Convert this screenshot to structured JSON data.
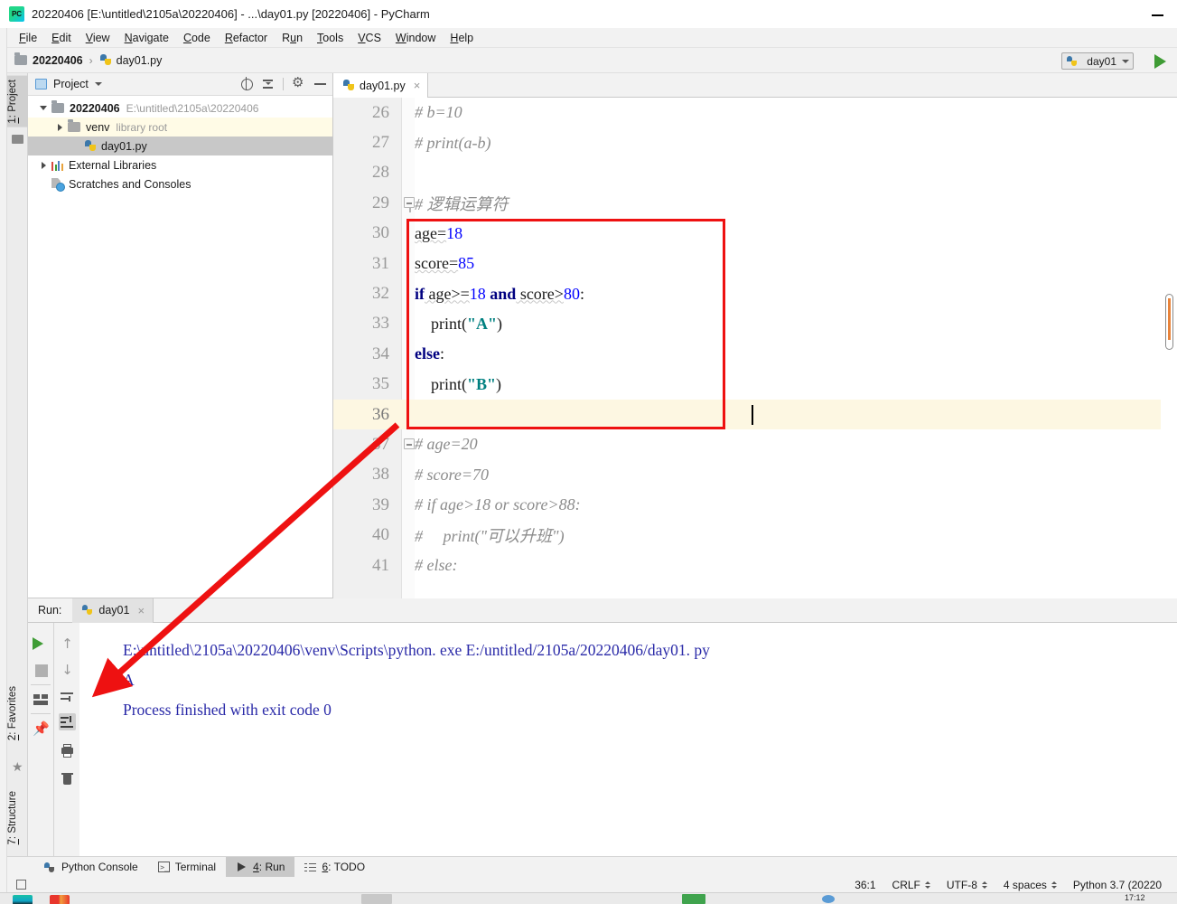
{
  "window": {
    "title": "20220406 [E:\\untitled\\2105a\\20220406] - ...\\day01.py [20220406] - PyCharm",
    "logo": "pycharm-logo",
    "minimize": "minimize-icon"
  },
  "menubar": {
    "items": [
      {
        "mnemonic": "F",
        "rest": "ile"
      },
      {
        "mnemonic": "E",
        "rest": "dit"
      },
      {
        "mnemonic": "V",
        "rest": "iew"
      },
      {
        "mnemonic": "N",
        "rest": "avigate"
      },
      {
        "mnemonic": "C",
        "rest": "ode"
      },
      {
        "mnemonic": "R",
        "rest": "efactor"
      },
      {
        "mnemonic": "R",
        "rest": "un",
        "pre": "R",
        "post": "un"
      },
      {
        "mnemonic": "T",
        "rest": "ools"
      },
      {
        "mnemonic": "V",
        "rest": "CS"
      },
      {
        "mnemonic": "W",
        "rest": "indow"
      },
      {
        "mnemonic": "H",
        "rest": "elp"
      }
    ],
    "labels": [
      "File",
      "Edit",
      "View",
      "Navigate",
      "Code",
      "Refactor",
      "Run",
      "Tools",
      "VCS",
      "Window",
      "Help"
    ]
  },
  "navbar": {
    "breadcrumb": [
      {
        "label": "20220406",
        "icon": "folder-icon",
        "bold": true
      },
      {
        "label": "day01.py",
        "icon": "python-file-icon",
        "bold": false
      }
    ],
    "separator": "›",
    "run_config": {
      "label": "day01",
      "icon": "python-config-icon"
    },
    "run_button": "run-icon"
  },
  "left_toolstrip": {
    "top_tab": {
      "mnemonic": "1",
      "label": ": Project"
    },
    "top_tab_full": "1: Project",
    "bottom_tabs": [
      {
        "mnemonic": "2",
        "label": ": Favorites",
        "full": "2: Favorites"
      },
      {
        "mnemonic": "7",
        "label": ": Structure",
        "full": "7: Structure"
      }
    ]
  },
  "project_panel": {
    "header": {
      "title": "Project",
      "icons": [
        "locate-target-icon",
        "collapse-all-icon",
        "gear-icon",
        "hide-icon"
      ]
    },
    "tree": [
      {
        "label": "20220406",
        "path": "E:\\untitled\\2105a\\20220406",
        "icon": "folder-icon",
        "expanded": true,
        "depth": 0,
        "bold": true
      },
      {
        "label": "venv",
        "sub": "library root",
        "icon": "folder-venv-icon",
        "expanded": false,
        "depth": 1,
        "highlight": "yellow"
      },
      {
        "label": "day01.py",
        "icon": "python-file-icon",
        "depth": 2,
        "highlight": "gray"
      },
      {
        "label": "External Libraries",
        "icon": "libraries-icon",
        "expanded": false,
        "depth": 0
      },
      {
        "label": "Scratches and Consoles",
        "icon": "scratches-icon",
        "depth": 0
      }
    ]
  },
  "editor": {
    "tab": {
      "label": "day01.py",
      "icon": "python-file-icon",
      "close": "×"
    },
    "caret_position": "36:1",
    "scrollbar": {
      "marker_color": "#e8833a"
    },
    "lines": [
      {
        "num": "26",
        "segments": [
          {
            "t": "# b=10",
            "c": "comment"
          }
        ]
      },
      {
        "num": "27",
        "segments": [
          {
            "t": "# print(a-b)",
            "c": "comment"
          }
        ]
      },
      {
        "num": "28",
        "segments": [
          {
            "t": "",
            "c": "plain"
          }
        ]
      },
      {
        "num": "29",
        "segments": [
          {
            "t": "# 逻辑运算符",
            "c": "comment"
          }
        ],
        "fold": "start"
      },
      {
        "num": "30",
        "segments": [
          {
            "t": "age=",
            "c": "plain"
          },
          {
            "t": "18",
            "c": "num"
          }
        ]
      },
      {
        "num": "31",
        "segments": [
          {
            "t": "score=",
            "c": "plain"
          },
          {
            "t": "85",
            "c": "num"
          }
        ]
      },
      {
        "num": "32",
        "segments": [
          {
            "t": "if",
            "c": "kw"
          },
          {
            "t": " age>=",
            "c": "plain"
          },
          {
            "t": "18",
            "c": "num"
          },
          {
            "t": " ",
            "c": "plain"
          },
          {
            "t": "and",
            "c": "kw"
          },
          {
            "t": " score>",
            "c": "plain"
          },
          {
            "t": "80",
            "c": "num"
          },
          {
            "t": ":",
            "c": "plain"
          }
        ]
      },
      {
        "num": "33",
        "segments": [
          {
            "t": "    print(",
            "c": "plain"
          },
          {
            "t": "\"A\"",
            "c": "str"
          },
          {
            "t": ")",
            "c": "plain"
          }
        ]
      },
      {
        "num": "34",
        "segments": [
          {
            "t": "else",
            "c": "kw"
          },
          {
            "t": ":",
            "c": "plain"
          }
        ]
      },
      {
        "num": "35",
        "segments": [
          {
            "t": "    print(",
            "c": "plain"
          },
          {
            "t": "\"B\"",
            "c": "str"
          },
          {
            "t": ")",
            "c": "plain"
          }
        ]
      },
      {
        "num": "36",
        "segments": [
          {
            "t": "",
            "c": "plain"
          }
        ],
        "current": true,
        "caret": true
      },
      {
        "num": "37",
        "segments": [
          {
            "t": "# age=20",
            "c": "comment"
          }
        ],
        "fold": "end"
      },
      {
        "num": "38",
        "segments": [
          {
            "t": "# score=70",
            "c": "comment"
          }
        ]
      },
      {
        "num": "39",
        "segments": [
          {
            "t": "# if age>18 or score>88:",
            "c": "comment"
          }
        ]
      },
      {
        "num": "40",
        "segments": [
          {
            "t": "#     print(\"可以升班\")",
            "c": "comment"
          }
        ]
      },
      {
        "num": "41",
        "segments": [
          {
            "t": "# else:",
            "c": "comment"
          }
        ]
      }
    ],
    "annotation": {
      "red_box": "highlight-rectangle",
      "red_arrow": "pointer-arrow"
    }
  },
  "run_panel": {
    "label": "Run:",
    "tab": {
      "label": "day01",
      "icon": "python-icon",
      "close": "×"
    },
    "toolbar_left": [
      "rerun-icon",
      "stop-icon",
      "layout-icon",
      "pin-icon"
    ],
    "toolbar_right": [
      "up-arrow-icon",
      "down-arrow-icon",
      "soft-wrap-icon",
      "scroll-to-end-icon",
      "print-icon",
      "trash-icon"
    ],
    "console_lines": [
      "E:\\untitled\\2105a\\20220406\\venv\\Scripts\\python. exe E:/untitled/2105a/20220406/day01. py",
      "A",
      "",
      "Process finished with exit code 0"
    ]
  },
  "bottom_toolbar": {
    "buttons": [
      {
        "label": "Python Console",
        "icon": "python-console-icon",
        "mnemonic": "",
        "active": false
      },
      {
        "label": "Terminal",
        "icon": "terminal-icon",
        "mnemonic": "",
        "active": false
      },
      {
        "label": "4: Run",
        "icon": "run-icon",
        "mnemonic": "4",
        "rest": ": Run",
        "active": true
      },
      {
        "label": "6: TODO",
        "icon": "todo-icon",
        "mnemonic": "6",
        "rest": ": TODO",
        "active": false
      }
    ]
  },
  "statusbar": {
    "items": [
      {
        "label": "36:1",
        "has_arrows": false
      },
      {
        "label": "CRLF",
        "has_arrows": true
      },
      {
        "label": "UTF-8",
        "has_arrows": true
      },
      {
        "label": "4 spaces",
        "has_arrows": true
      },
      {
        "label": "Python 3.7 (20220",
        "has_arrows": false
      }
    ],
    "clock": "17:12"
  },
  "colors": {
    "accent_red": "#ee1111",
    "keyword": "#000080",
    "number": "#0000ff",
    "string": "#008080",
    "comment": "#8c8c8c",
    "console_text": "#2a2aa8",
    "scrollbar_marker": "#e8833a",
    "run_green": "#3f9c35"
  }
}
